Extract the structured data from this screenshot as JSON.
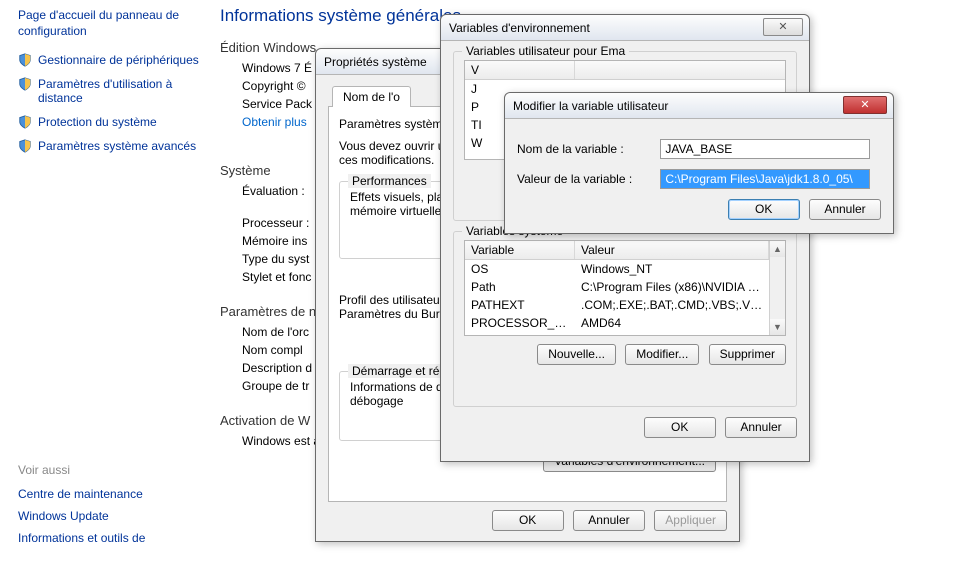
{
  "sidebar": {
    "home": "Page d'accueil du panneau de configuration",
    "items": [
      "Gestionnaire de périphériques",
      "Paramètres d'utilisation à distance",
      "Protection du système",
      "Paramètres système avancés"
    ],
    "seealso_head": "Voir aussi",
    "seealso": [
      "Centre de maintenance",
      "Windows Update",
      "Informations et outils de"
    ]
  },
  "main": {
    "title": "Informations système générales",
    "edition_head": "Édition Windows",
    "edition_line1": "Windows 7 É",
    "edition_line2": "Copyright ©",
    "edition_line3": "Service Pack",
    "edition_link": "Obtenir plus",
    "system_head": "Système",
    "system_rows": [
      "Évaluation :",
      "Processeur :",
      "Mémoire ins",
      "Type du syst",
      "Stylet et fonc"
    ],
    "name_head": "Paramètres de n",
    "name_rows": [
      "Nom de l'orc",
      "Nom compl",
      "Description d",
      "Groupe de tr"
    ],
    "activation_head": "Activation de W",
    "activation_line": "Windows est activé."
  },
  "sysprops": {
    "title": "Propriétés système",
    "tab": "Nom de l'o",
    "group_title": "Paramètres système a",
    "text1": "Vous devez ouvrir u",
    "text2": "ces modifications.",
    "perf_head": "Performances",
    "perf_text": "Effets visuels, plani\nmémoire virtuelle",
    "profile_head": "Profil des utilisateur",
    "profile_text": "Paramètres du Bure",
    "startup_head": "Démarrage et récup",
    "startup_text": "Informations de dér\ndébogage",
    "envvar_btn": "Variables d'environnement...",
    "ok": "OK",
    "cancel": "Annuler",
    "apply": "Appliquer"
  },
  "envdialog": {
    "title": "Variables d'environnement",
    "user_head": "Variables utilisateur pour Ema",
    "col_var": "Variable",
    "col_val": "Valeur",
    "user_vars_cut": [
      "V",
      "J",
      "P",
      "TI",
      "W"
    ],
    "sys_head": "Variables système",
    "sys_vars": [
      {
        "name": "OS",
        "value": "Windows_NT"
      },
      {
        "name": "Path",
        "value": "C:\\Program Files (x86)\\NVIDIA Corpora..."
      },
      {
        "name": "PATHEXT",
        "value": ".COM;.EXE;.BAT;.CMD;.VBS;.VBE;.JS;..."
      },
      {
        "name": "PROCESSOR_A...",
        "value": "AMD64"
      }
    ],
    "new_btn": "Nouvelle...",
    "edit_btn": "Modifier...",
    "del_btn": "Supprimer",
    "ok": "OK",
    "cancel": "Annuler"
  },
  "editdialog": {
    "title": "Modifier la variable utilisateur",
    "name_label": "Nom de la variable :",
    "name_value": "JAVA_BASE",
    "value_label": "Valeur de la variable :",
    "value_value": "C:\\Program Files\\Java\\jdk1.8.0_05\\",
    "ok": "OK",
    "cancel": "Annuler"
  }
}
